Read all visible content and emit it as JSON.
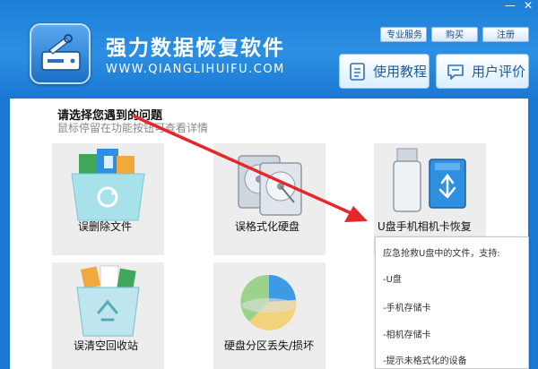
{
  "window": {
    "minimize_icon": "minimize-icon",
    "close_icon": "close-icon"
  },
  "header": {
    "title_cn": "强力数据恢复软件",
    "title_en": "WWW.QIANGLIHUIFU.COM",
    "links": [
      "专业服务",
      "购买",
      "注册"
    ],
    "buttons": [
      {
        "label": "使用教程",
        "icon": "document-icon"
      },
      {
        "label": "用户评价",
        "icon": "chat-icon"
      }
    ]
  },
  "main": {
    "prompt_title": "请选择您遇到的问题",
    "prompt_subtitle": "鼠标停留在功能按钮可查看详情",
    "features": [
      {
        "label": "误删除文件",
        "icon": "folder-recycle-icon"
      },
      {
        "label": "误格式化硬盘",
        "icon": "hard-drive-icon"
      },
      {
        "label": "U盘手机相机卡恢复",
        "icon": "usb-sd-card-icon"
      },
      {
        "label": "误清空回收站",
        "icon": "recycle-bin-icon"
      },
      {
        "label": "硬盘分区丢失/损坏",
        "icon": "pie-chart-icon"
      }
    ]
  },
  "tooltip": {
    "heading": "应急抢救U盘中的文件，支持:",
    "items": [
      "-U盘",
      "-手机存储卡",
      "-相机存储卡",
      "-提示未格式化的设备"
    ]
  },
  "colors": {
    "header_blue": "#1d7fd8",
    "tile_gray": "#ededed",
    "arrow_red": "#e8262a"
  }
}
